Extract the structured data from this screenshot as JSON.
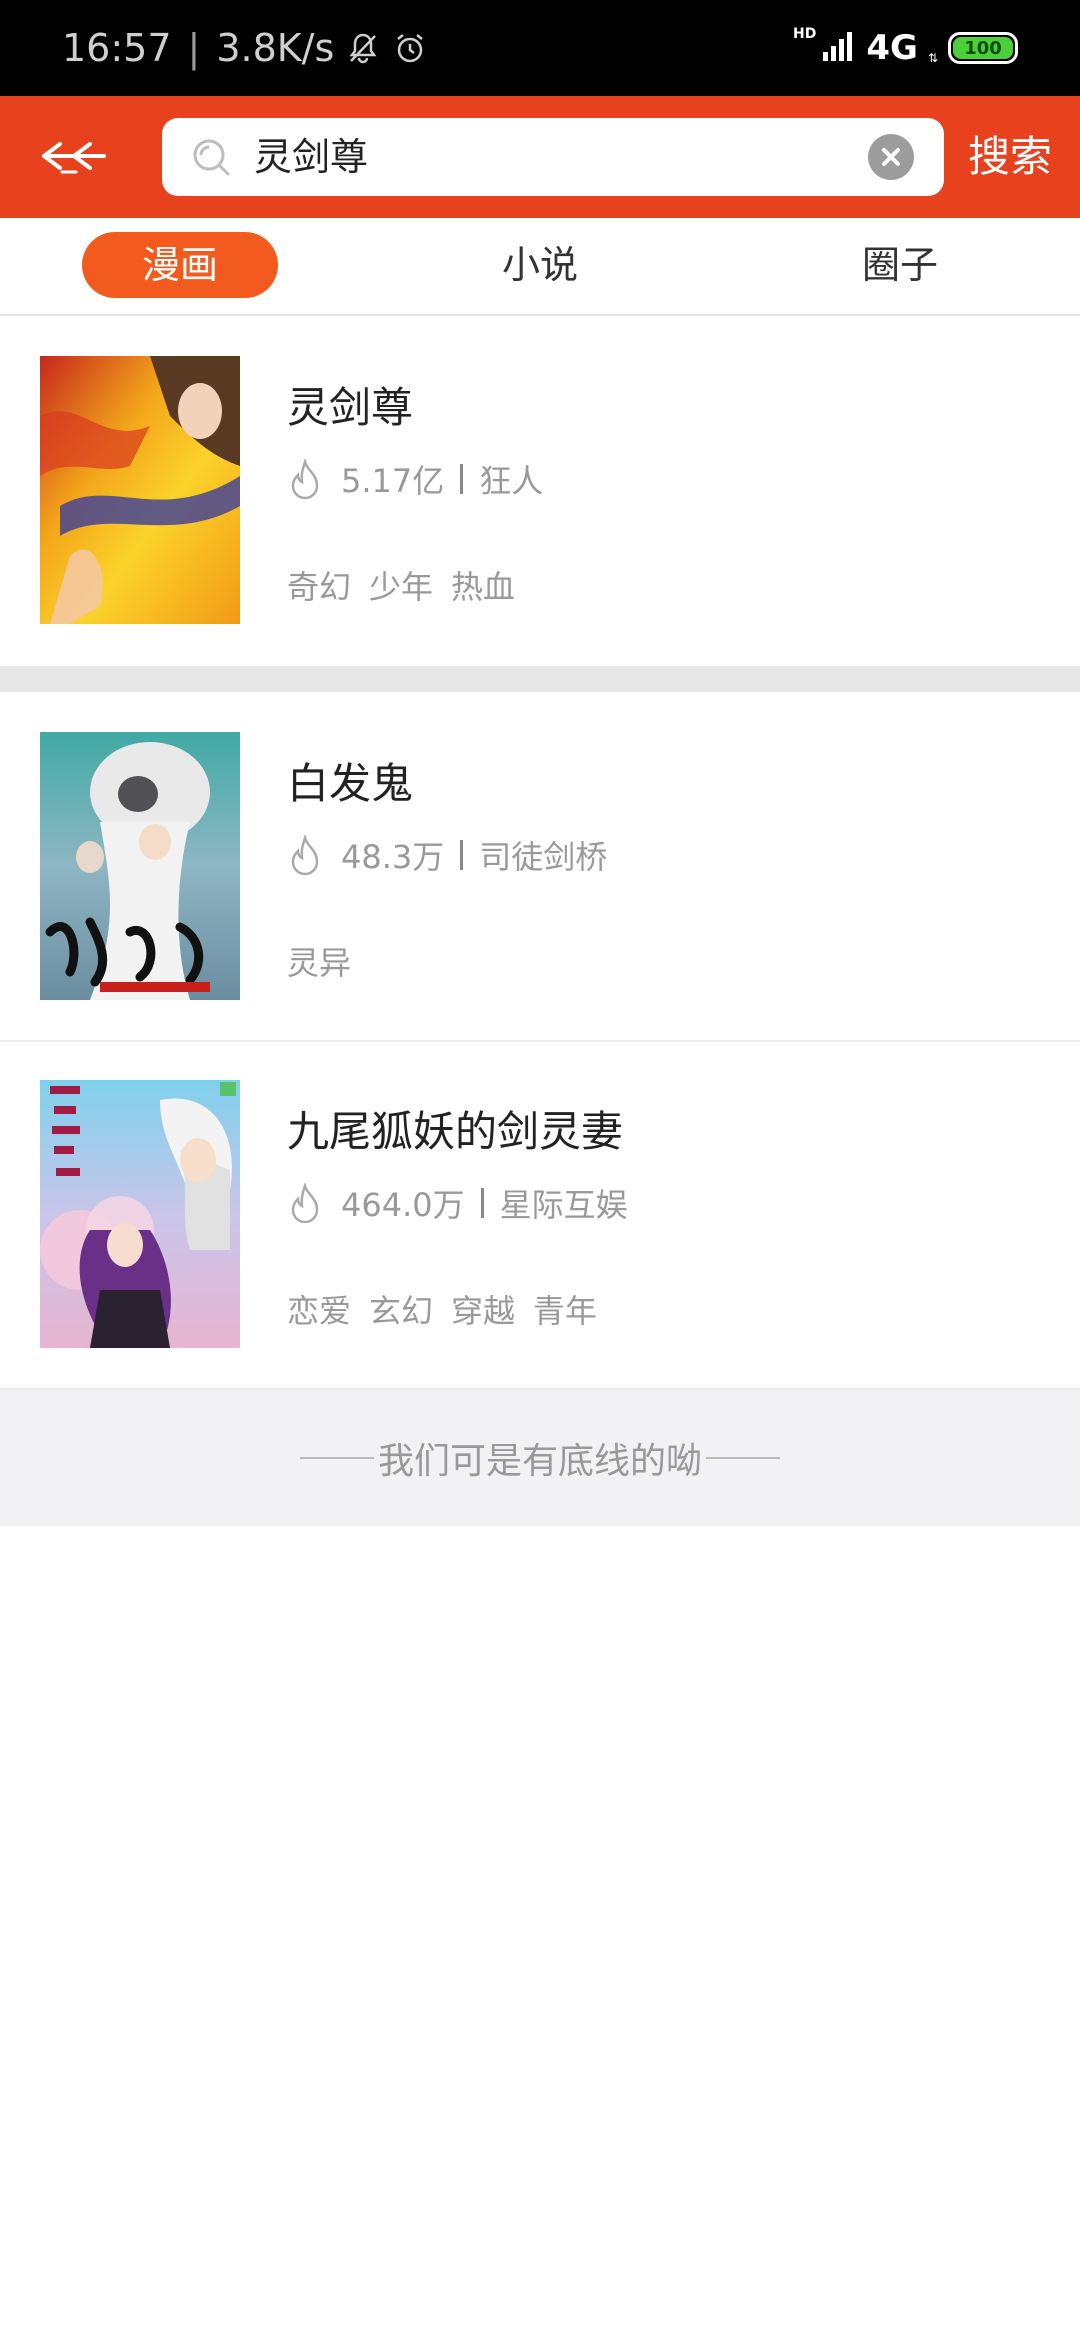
{
  "status_bar": {
    "time": "16:57",
    "speed": "3.8K/s",
    "hd": "HD",
    "network": "4G",
    "battery": "100"
  },
  "header": {
    "search_query": "灵剑尊",
    "search_button": "搜索"
  },
  "tabs": [
    {
      "label": "漫画",
      "active": true
    },
    {
      "label": "小说",
      "active": false
    },
    {
      "label": "圈子",
      "active": false
    }
  ],
  "results": [
    {
      "title": "灵剑尊",
      "heat": "5.17亿",
      "author": "狂人",
      "tags": [
        "奇幻",
        "少年",
        "热血"
      ]
    },
    {
      "title": "白发鬼",
      "heat": "48.3万",
      "author": "司徒剑桥",
      "tags": [
        "灵异"
      ]
    },
    {
      "title": "九尾狐妖的剑灵妻",
      "heat": "464.0万",
      "author": "星际互娱",
      "tags": [
        "恋爱",
        "玄幻",
        "穿越",
        "青年"
      ]
    }
  ],
  "footer_text": "我们可是有底线的呦",
  "colors": {
    "brand": "#e8411e",
    "tab_active": "#f25a1e"
  }
}
